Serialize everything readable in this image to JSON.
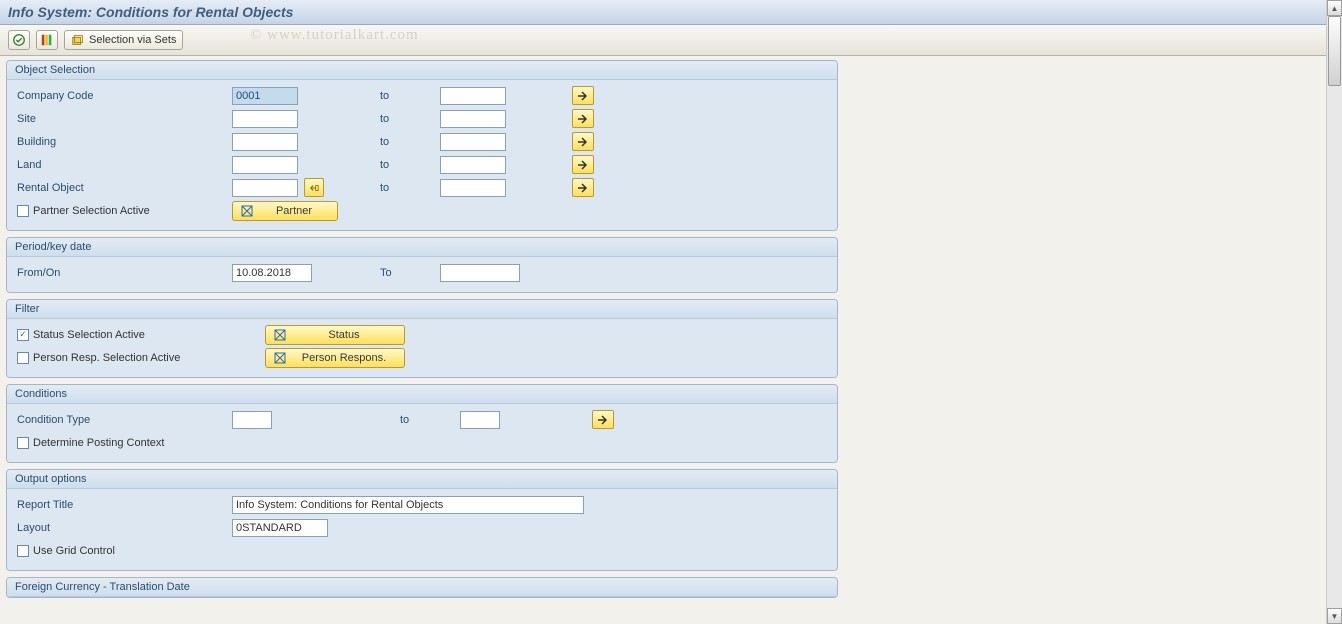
{
  "window": {
    "title": "Info System: Conditions for Rental Objects"
  },
  "toolbar": {
    "selection_via_sets": "Selection via Sets"
  },
  "watermark": "© www.tutorialkart.com",
  "sections": {
    "object_selection": {
      "title": "Object Selection",
      "company_code": {
        "label": "Company Code",
        "from": "0001",
        "to_label": "to",
        "to": ""
      },
      "site": {
        "label": "Site",
        "from": "",
        "to_label": "to",
        "to": ""
      },
      "building": {
        "label": "Building",
        "from": "",
        "to_label": "to",
        "to": ""
      },
      "land": {
        "label": "Land",
        "from": "",
        "to_label": "to",
        "to": ""
      },
      "rental_object": {
        "label": "Rental Object",
        "from": "",
        "to_label": "to",
        "to": ""
      },
      "partner_sel": {
        "label": "Partner Selection Active",
        "checked": false
      },
      "partner_btn": "Partner"
    },
    "period": {
      "title": "Period/key date",
      "from_on": {
        "label": "From/On",
        "value": "10.08.2018",
        "to_label": "To",
        "to": ""
      }
    },
    "filter": {
      "title": "Filter",
      "status_sel": {
        "label": "Status Selection Active",
        "checked": true
      },
      "status_btn": "Status",
      "person_sel": {
        "label": "Person Resp. Selection Active",
        "checked": false
      },
      "person_btn": "Person Respons."
    },
    "conditions": {
      "title": "Conditions",
      "condition_type": {
        "label": "Condition Type",
        "from": "",
        "to_label": "to",
        "to": ""
      },
      "posting_ctx": {
        "label": "Determine Posting Context",
        "checked": false
      }
    },
    "output": {
      "title": "Output options",
      "report_title": {
        "label": "Report Title",
        "value": "Info System: Conditions for Rental Objects"
      },
      "layout": {
        "label": "Layout",
        "value": "0STANDARD"
      },
      "grid": {
        "label": "Use Grid Control",
        "checked": false
      }
    },
    "foreign_currency": {
      "title": "Foreign Currency - Translation Date"
    }
  }
}
